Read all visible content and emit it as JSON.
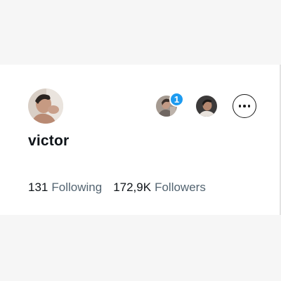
{
  "profile": {
    "display_name": "victor",
    "avatar_icon": "profile-photo"
  },
  "header_actions": {
    "mutual_1": {
      "icon": "mutual-follower-avatar",
      "badge_count": "1"
    },
    "mutual_2": {
      "icon": "mutual-follower-avatar"
    },
    "more_icon": "ellipsis-icon"
  },
  "stats": {
    "following_count": "131",
    "following_label": "Following",
    "followers_count": "172,9K",
    "followers_label": "Followers"
  },
  "colors": {
    "badge": "#1d9bf0",
    "text_primary": "#0f1419",
    "text_secondary": "#536471"
  }
}
